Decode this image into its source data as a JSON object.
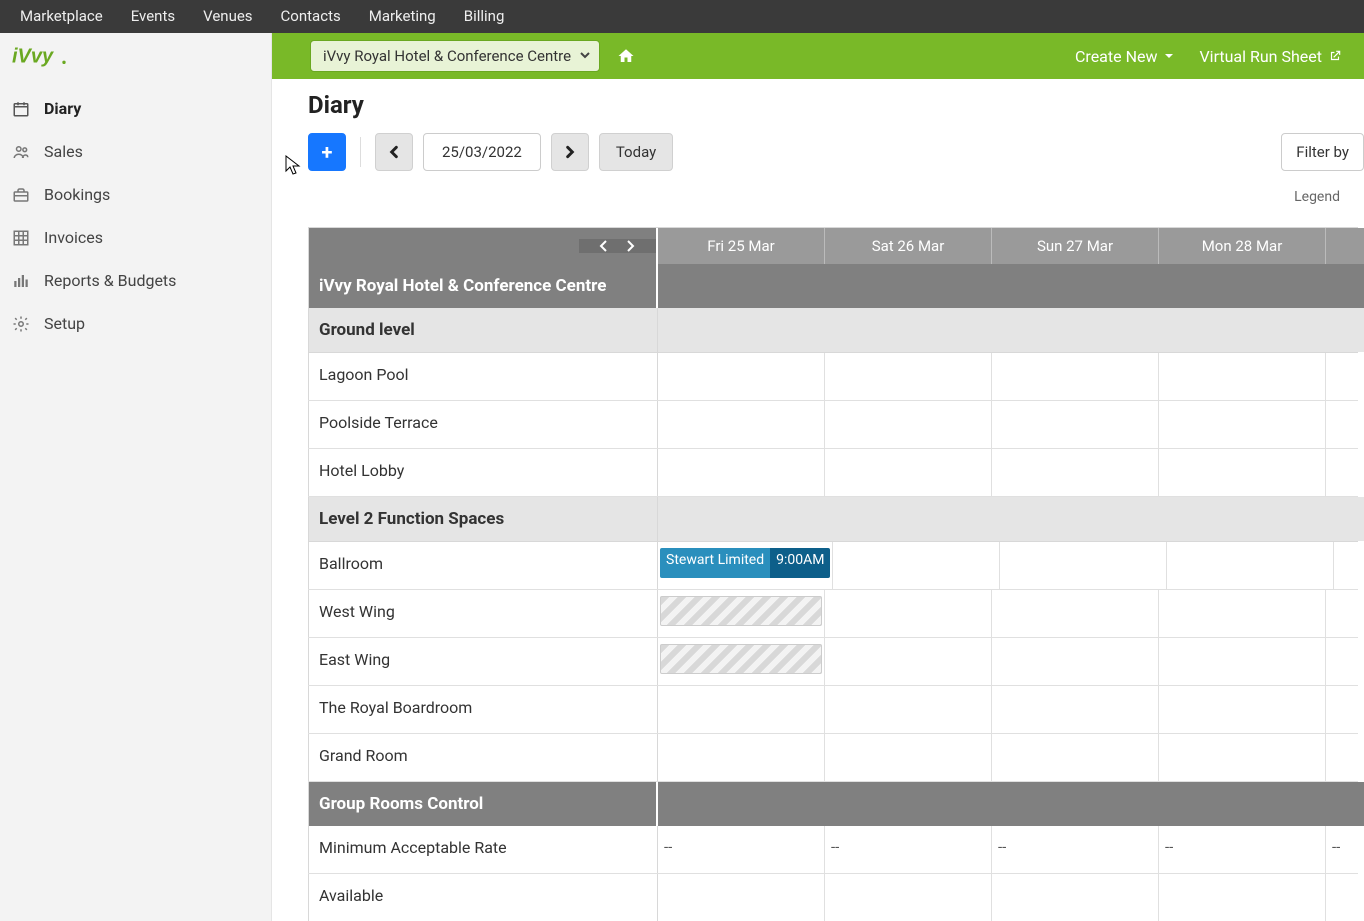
{
  "topnav": [
    "Marketplace",
    "Events",
    "Venues",
    "Contacts",
    "Marketing",
    "Billing"
  ],
  "sidebar": {
    "items": [
      {
        "label": "Diary",
        "icon": "calendar",
        "active": true
      },
      {
        "label": "Sales",
        "icon": "people",
        "active": false
      },
      {
        "label": "Bookings",
        "icon": "briefcase",
        "active": false
      },
      {
        "label": "Invoices",
        "icon": "grid",
        "active": false
      },
      {
        "label": "Reports & Budgets",
        "icon": "bars",
        "active": false
      },
      {
        "label": "Setup",
        "icon": "gear",
        "active": false
      }
    ]
  },
  "greenbar": {
    "venue": "iVvy Royal Hotel & Conference Centre",
    "create_new": "Create New",
    "virtual_run_sheet": "Virtual Run Sheet"
  },
  "page": {
    "title": "Diary",
    "date": "25/03/2022",
    "today": "Today",
    "filter_by": "Filter by",
    "legend": "Legend"
  },
  "diary": {
    "days": [
      "Fri 25 Mar",
      "Sat 26 Mar",
      "Sun 27 Mar",
      "Mon 28 Mar",
      ""
    ],
    "rows": [
      {
        "type": "section",
        "label": "iVvy Royal Hotel & Conference Centre"
      },
      {
        "type": "subsection",
        "label": "Ground level"
      },
      {
        "type": "room",
        "label": "Lagoon Pool"
      },
      {
        "type": "room",
        "label": "Poolside Terrace"
      },
      {
        "type": "room",
        "label": "Hotel Lobby"
      },
      {
        "type": "subsection",
        "label": "Level 2 Function Spaces"
      },
      {
        "type": "room",
        "label": "Ballroom",
        "booking": {
          "name": "Stewart Limited",
          "time": "9:00AM"
        }
      },
      {
        "type": "room",
        "label": "West Wing",
        "hatched": true
      },
      {
        "type": "room",
        "label": "East Wing",
        "hatched": true
      },
      {
        "type": "room",
        "label": "The Royal Boardroom"
      },
      {
        "type": "room",
        "label": "Grand Room"
      },
      {
        "type": "section",
        "label": "Group Rooms Control"
      },
      {
        "type": "data",
        "label": "Minimum Acceptable Rate",
        "cells": [
          "--",
          "--",
          "--",
          "--",
          "--"
        ]
      },
      {
        "type": "data",
        "label": "Available"
      }
    ]
  }
}
